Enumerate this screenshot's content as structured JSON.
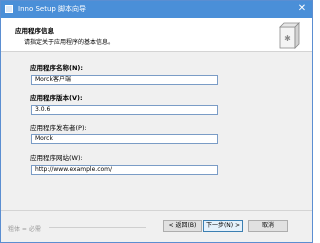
{
  "window": {
    "title": "Inno Setup 脚本向导",
    "close_glyph": "✕"
  },
  "header": {
    "title": "应用程序信息",
    "subtitle": "请指定关于应用程序的基本信息。"
  },
  "fields": [
    {
      "label": "应用程序名称(N):",
      "value": "Morck客户端"
    },
    {
      "label": "应用程序版本(V):",
      "value": "3.0.6"
    },
    {
      "label": "应用程序发布者(P):",
      "value": "Morck"
    },
    {
      "label": "应用程序网站(W):",
      "value": "http://www.example.com/"
    }
  ],
  "footer": {
    "brand_text": "粗体 = 必需",
    "back_label": "< 返回(B)",
    "next_label": "下一步(N) >",
    "cancel_label": "取消"
  },
  "colors": {
    "titlebar": "#4a8fd8",
    "accent": "#3c7fb1"
  },
  "icons": {
    "app_icon": "window-icon",
    "wizard_image": "setup-box-icon"
  }
}
